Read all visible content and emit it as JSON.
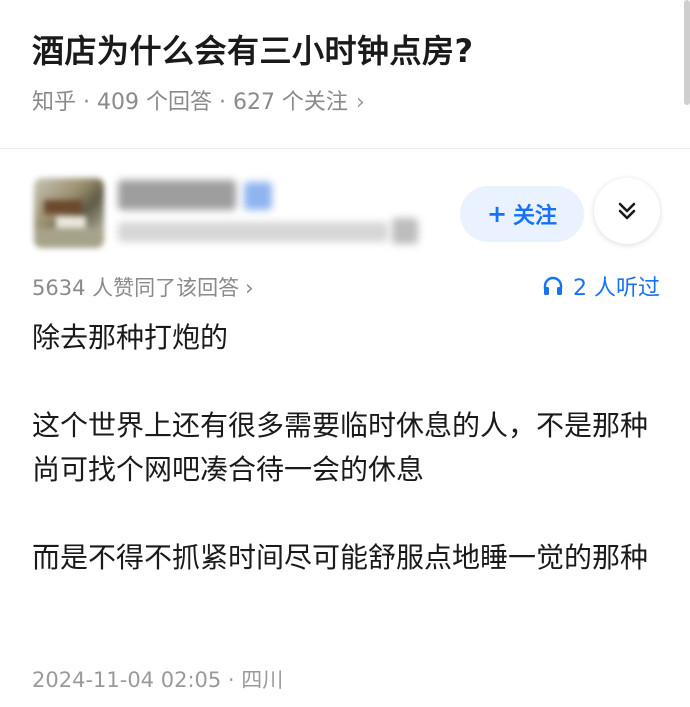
{
  "question": {
    "title": "酒店为什么会有三小时钟点房?",
    "meta": "知乎 · 409 个回答 · 627 个关注"
  },
  "author": {
    "follow_label": "关注",
    "follow_icon": "plus-icon",
    "more_icon": "chevron-double-down-icon"
  },
  "answer": {
    "vote_summary": "5634 人赞同了该回答",
    "listen_count_label": "2 人听过",
    "paragraphs": [
      "除去那种打炮的",
      "这个世界上还有很多需要临时休息的人，不是那种尚可找个网吧凑合待一会的休息",
      "而是不得不抓紧时间尽可能舒服点地睡一觉的那种"
    ],
    "footer": "2024-11-04 02:05 · 四川"
  },
  "colors": {
    "accent": "#1772f6",
    "follow_bg": "#eaf2ff",
    "meta_gray": "#8a8a8a"
  }
}
